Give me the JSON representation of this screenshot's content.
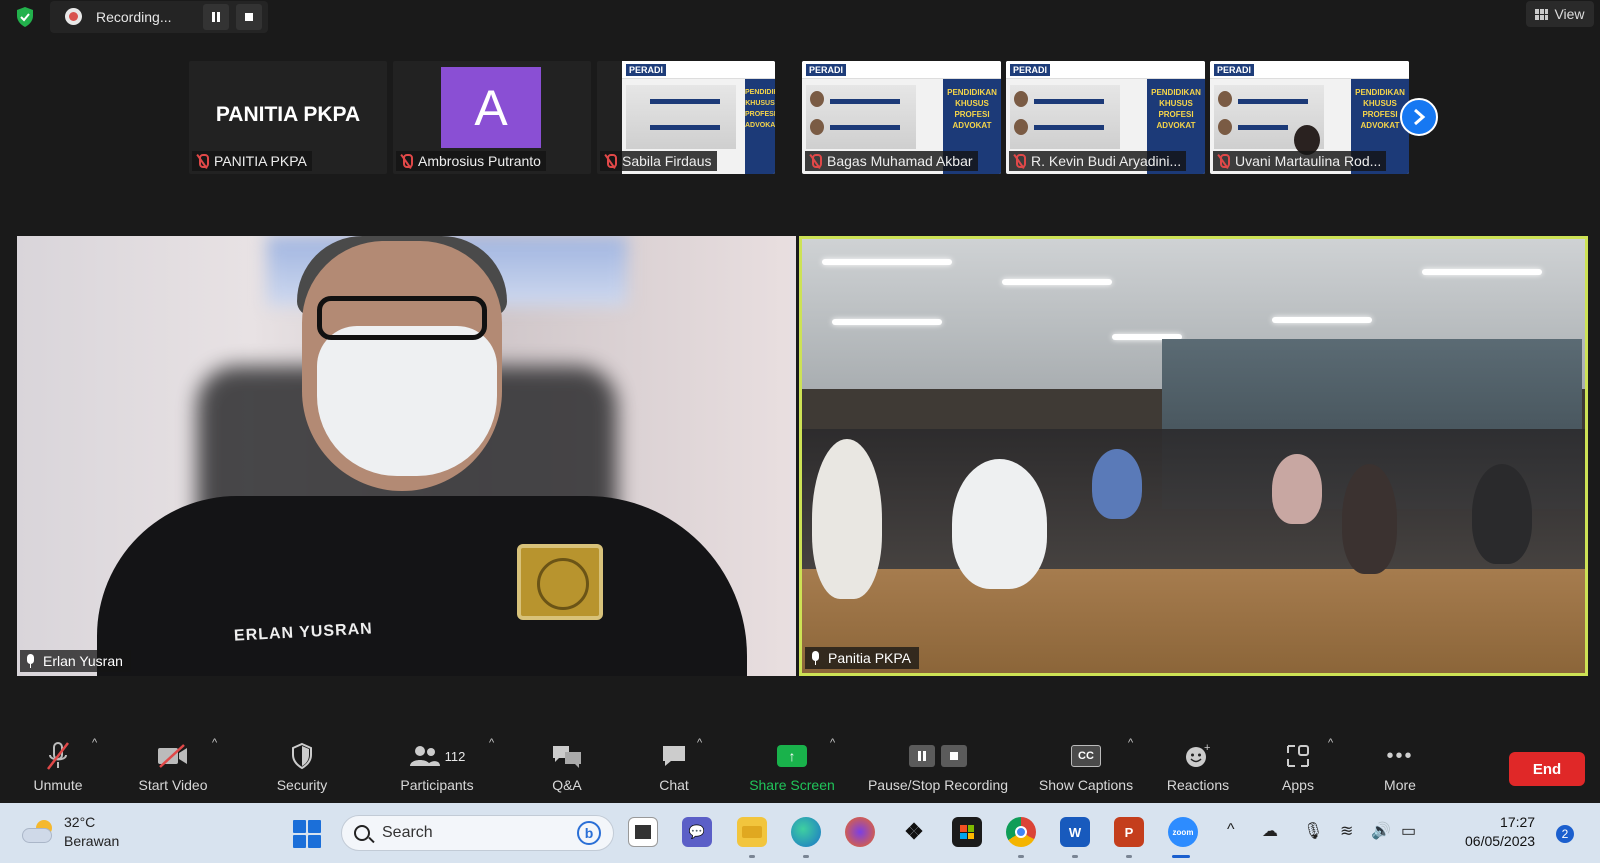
{
  "topbar": {
    "recording_text": "Recording...",
    "pause_icon": "pause-icon",
    "stop_icon": "stop-icon",
    "view_label": "View"
  },
  "thumbnails": [
    {
      "name": "PANITIA PKPA",
      "display": "PANITIA PKPA",
      "type": "text"
    },
    {
      "name": "Ambrosius Putranto",
      "display": "A",
      "type": "avatar",
      "color": "#8a4fd4"
    },
    {
      "name": "Sabila Firdaus",
      "type": "poster"
    },
    {
      "name": "Bagas Muhamad Akbar",
      "type": "poster"
    },
    {
      "name": "R. Kevin Budi Aryadini...",
      "type": "poster"
    },
    {
      "name": "Uvani Martaulina Rod...",
      "type": "poster"
    }
  ],
  "poster": {
    "brand": "PERADI",
    "side_text": "PENDIDIKAN KHUSUS PROFESI ADVOKAT"
  },
  "main_tiles": [
    {
      "name": "Erlan Yusran",
      "patch_text": "ERLAN YUSRAN"
    },
    {
      "name": "Panitia PKPA",
      "active_speaker": true
    }
  ],
  "controls": {
    "unmute": "Unmute",
    "start_video": "Start Video",
    "security": "Security",
    "participants": "Participants",
    "participants_count": "112",
    "qa": "Q&A",
    "chat": "Chat",
    "share_screen": "Share Screen",
    "pause_stop_recording": "Pause/Stop Recording",
    "show_captions": "Show Captions",
    "captions_icon_text": "CC",
    "reactions": "Reactions",
    "apps": "Apps",
    "more": "More",
    "end": "End"
  },
  "taskbar": {
    "temperature": "32°C",
    "weather": "Berawan",
    "search_placeholder": "Search",
    "time": "17:27",
    "date": "06/05/2023",
    "notification_count": "2"
  },
  "colors": {
    "active_speaker_border": "#cde255",
    "share_green": "#19b24b",
    "end_red": "#e02828",
    "next_blue": "#1678f2"
  }
}
